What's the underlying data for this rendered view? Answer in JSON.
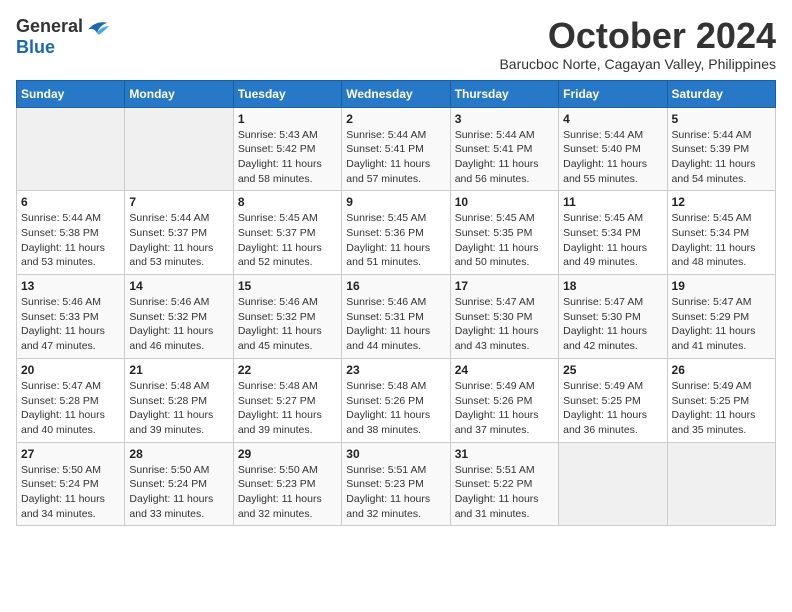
{
  "logo": {
    "general": "General",
    "blue": "Blue"
  },
  "title": "October 2024",
  "subtitle": "Barucboc Norte, Cagayan Valley, Philippines",
  "weekdays": [
    "Sunday",
    "Monday",
    "Tuesday",
    "Wednesday",
    "Thursday",
    "Friday",
    "Saturday"
  ],
  "weeks": [
    [
      {
        "day": "",
        "empty": true
      },
      {
        "day": "",
        "empty": true
      },
      {
        "day": "1",
        "sunrise": "5:43 AM",
        "sunset": "5:42 PM",
        "daylight": "11 hours and 58 minutes."
      },
      {
        "day": "2",
        "sunrise": "5:44 AM",
        "sunset": "5:41 PM",
        "daylight": "11 hours and 57 minutes."
      },
      {
        "day": "3",
        "sunrise": "5:44 AM",
        "sunset": "5:41 PM",
        "daylight": "11 hours and 56 minutes."
      },
      {
        "day": "4",
        "sunrise": "5:44 AM",
        "sunset": "5:40 PM",
        "daylight": "11 hours and 55 minutes."
      },
      {
        "day": "5",
        "sunrise": "5:44 AM",
        "sunset": "5:39 PM",
        "daylight": "11 hours and 54 minutes."
      }
    ],
    [
      {
        "day": "6",
        "sunrise": "5:44 AM",
        "sunset": "5:38 PM",
        "daylight": "11 hours and 53 minutes."
      },
      {
        "day": "7",
        "sunrise": "5:44 AM",
        "sunset": "5:37 PM",
        "daylight": "11 hours and 53 minutes."
      },
      {
        "day": "8",
        "sunrise": "5:45 AM",
        "sunset": "5:37 PM",
        "daylight": "11 hours and 52 minutes."
      },
      {
        "day": "9",
        "sunrise": "5:45 AM",
        "sunset": "5:36 PM",
        "daylight": "11 hours and 51 minutes."
      },
      {
        "day": "10",
        "sunrise": "5:45 AM",
        "sunset": "5:35 PM",
        "daylight": "11 hours and 50 minutes."
      },
      {
        "day": "11",
        "sunrise": "5:45 AM",
        "sunset": "5:34 PM",
        "daylight": "11 hours and 49 minutes."
      },
      {
        "day": "12",
        "sunrise": "5:45 AM",
        "sunset": "5:34 PM",
        "daylight": "11 hours and 48 minutes."
      }
    ],
    [
      {
        "day": "13",
        "sunrise": "5:46 AM",
        "sunset": "5:33 PM",
        "daylight": "11 hours and 47 minutes."
      },
      {
        "day": "14",
        "sunrise": "5:46 AM",
        "sunset": "5:32 PM",
        "daylight": "11 hours and 46 minutes."
      },
      {
        "day": "15",
        "sunrise": "5:46 AM",
        "sunset": "5:32 PM",
        "daylight": "11 hours and 45 minutes."
      },
      {
        "day": "16",
        "sunrise": "5:46 AM",
        "sunset": "5:31 PM",
        "daylight": "11 hours and 44 minutes."
      },
      {
        "day": "17",
        "sunrise": "5:47 AM",
        "sunset": "5:30 PM",
        "daylight": "11 hours and 43 minutes."
      },
      {
        "day": "18",
        "sunrise": "5:47 AM",
        "sunset": "5:30 PM",
        "daylight": "11 hours and 42 minutes."
      },
      {
        "day": "19",
        "sunrise": "5:47 AM",
        "sunset": "5:29 PM",
        "daylight": "11 hours and 41 minutes."
      }
    ],
    [
      {
        "day": "20",
        "sunrise": "5:47 AM",
        "sunset": "5:28 PM",
        "daylight": "11 hours and 40 minutes."
      },
      {
        "day": "21",
        "sunrise": "5:48 AM",
        "sunset": "5:28 PM",
        "daylight": "11 hours and 39 minutes."
      },
      {
        "day": "22",
        "sunrise": "5:48 AM",
        "sunset": "5:27 PM",
        "daylight": "11 hours and 39 minutes."
      },
      {
        "day": "23",
        "sunrise": "5:48 AM",
        "sunset": "5:26 PM",
        "daylight": "11 hours and 38 minutes."
      },
      {
        "day": "24",
        "sunrise": "5:49 AM",
        "sunset": "5:26 PM",
        "daylight": "11 hours and 37 minutes."
      },
      {
        "day": "25",
        "sunrise": "5:49 AM",
        "sunset": "5:25 PM",
        "daylight": "11 hours and 36 minutes."
      },
      {
        "day": "26",
        "sunrise": "5:49 AM",
        "sunset": "5:25 PM",
        "daylight": "11 hours and 35 minutes."
      }
    ],
    [
      {
        "day": "27",
        "sunrise": "5:50 AM",
        "sunset": "5:24 PM",
        "daylight": "11 hours and 34 minutes."
      },
      {
        "day": "28",
        "sunrise": "5:50 AM",
        "sunset": "5:24 PM",
        "daylight": "11 hours and 33 minutes."
      },
      {
        "day": "29",
        "sunrise": "5:50 AM",
        "sunset": "5:23 PM",
        "daylight": "11 hours and 32 minutes."
      },
      {
        "day": "30",
        "sunrise": "5:51 AM",
        "sunset": "5:23 PM",
        "daylight": "11 hours and 32 minutes."
      },
      {
        "day": "31",
        "sunrise": "5:51 AM",
        "sunset": "5:22 PM",
        "daylight": "11 hours and 31 minutes."
      },
      {
        "day": "",
        "empty": true
      },
      {
        "day": "",
        "empty": true
      }
    ]
  ]
}
